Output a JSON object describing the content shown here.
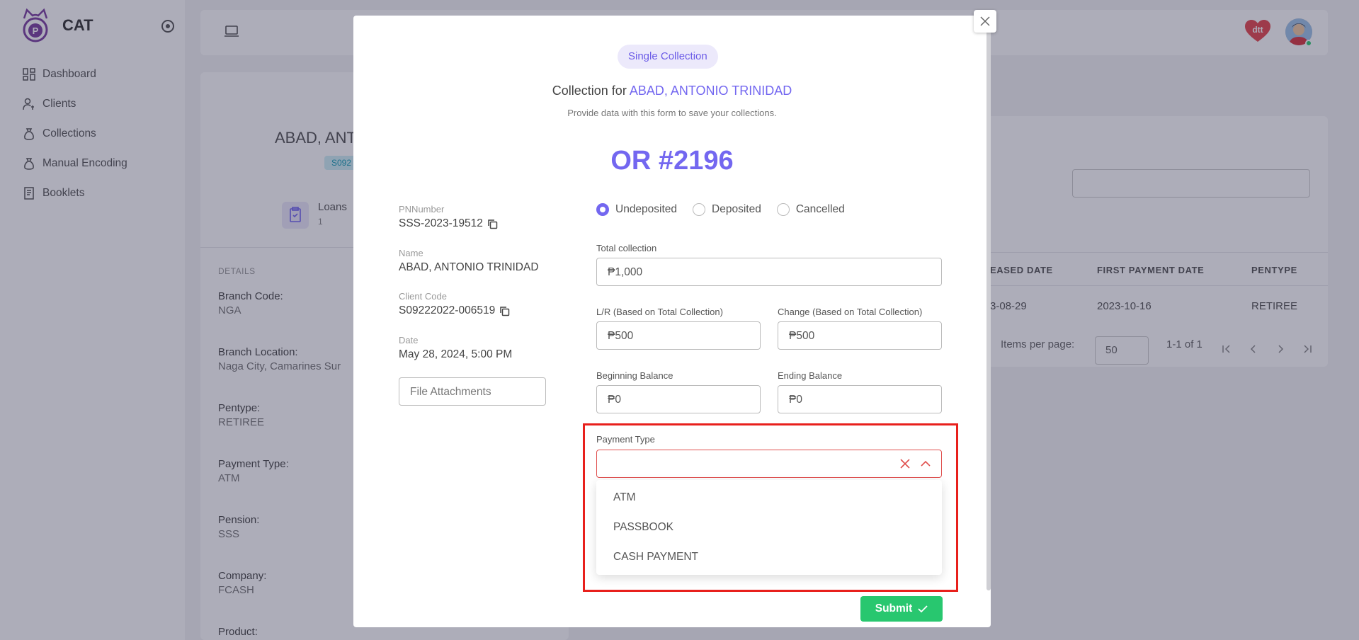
{
  "app": {
    "name": "CAT"
  },
  "sidebar": {
    "items": [
      {
        "label": "Dashboard",
        "icon": "dashboard-icon"
      },
      {
        "label": "Clients",
        "icon": "clients-icon"
      },
      {
        "label": "Collections",
        "icon": "money-bag-icon"
      },
      {
        "label": "Manual Encoding",
        "icon": "money-bag-icon"
      },
      {
        "label": "Booklets",
        "icon": "booklet-icon"
      }
    ]
  },
  "background": {
    "client_name": "ABAD, ANT",
    "client_code_badge": "S092",
    "loans_label": "Loans",
    "loans_count": "1",
    "details_heading": "DETAILS",
    "details": [
      {
        "label": "Branch Code:",
        "value": "NGA"
      },
      {
        "label": "Branch Location:",
        "value": "Naga City, Camarines Sur"
      },
      {
        "label": "Pentype:",
        "value": "RETIREE"
      },
      {
        "label": "Payment Type:",
        "value": "ATM"
      },
      {
        "label": "Pension:",
        "value": "SSS"
      },
      {
        "label": "Company:",
        "value": "FCASH"
      },
      {
        "label": "Product:",
        "value": ""
      }
    ],
    "table": {
      "headers": [
        "EASED DATE",
        "FIRST PAYMENT DATE",
        "PENTYPE"
      ],
      "row": [
        "3-08-29",
        "2023-10-16",
        "RETIREE"
      ],
      "items_per_page_label": "Items per page:",
      "items_per_page_value": "50",
      "range": "1-1 of 1"
    }
  },
  "modal": {
    "chip": "Single Collection",
    "collection_for_prefix": "Collection for",
    "client_name": "ABAD, ANTONIO TRINIDAD",
    "hint": "Provide data with this form to save your collections.",
    "or_number": "OR #2196",
    "info": {
      "pn_label": "PNNumber",
      "pn_value": "SSS-2023-19512",
      "name_label": "Name",
      "name_value": "ABAD, ANTONIO TRINIDAD",
      "code_label": "Client Code",
      "code_value": "S09222022-006519",
      "date_label": "Date",
      "date_value": "May 28, 2024, 5:00 PM"
    },
    "file_attachments": "File Attachments",
    "status_options": [
      {
        "label": "Undeposited",
        "checked": true
      },
      {
        "label": "Deposited",
        "checked": false
      },
      {
        "label": "Cancelled",
        "checked": false
      }
    ],
    "total_collection": {
      "label": "Total collection",
      "value": "₱1,000"
    },
    "lr": {
      "label": "L/R (Based on Total Collection)",
      "value": "₱500"
    },
    "change": {
      "label": "Change (Based on Total Collection)",
      "value": "₱500"
    },
    "beginning_balance": {
      "label": "Beginning Balance",
      "value": "₱0"
    },
    "ending_balance": {
      "label": "Ending Balance",
      "value": "₱0"
    },
    "payment_type": {
      "label": "Payment Type",
      "value": "",
      "options": [
        "ATM",
        "PASSBOOK",
        "CASH PAYMENT"
      ]
    },
    "submit_label": "Submit"
  },
  "colors": {
    "accent": "#7367f0",
    "success": "#28c76f",
    "error": "#e0504e",
    "highlight": "#e8201c"
  }
}
